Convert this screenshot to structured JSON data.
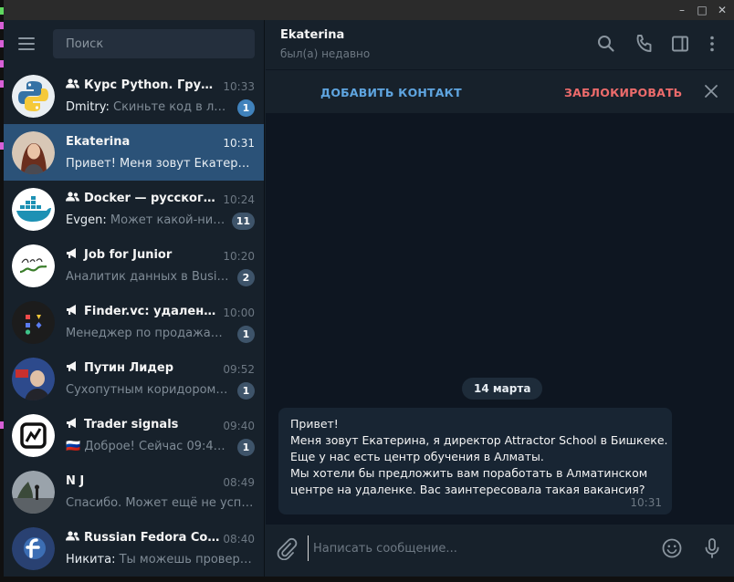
{
  "window": {
    "minimize_glyph": "–",
    "maximize_glyph": "□",
    "close_glyph": "✕"
  },
  "sidebar": {
    "search_placeholder": "Поиск",
    "chats": [
      {
        "title": "Курс Python. Группа ...",
        "type": "group",
        "time": "10:33",
        "sender": "Dmitry: ",
        "preview": "Скиньте код в личку",
        "unread": "1",
        "active": false
      },
      {
        "title": "Ekaterina",
        "type": "user",
        "time": "10:31",
        "sender": "",
        "preview": "Привет!  Меня зовут Екатерин...",
        "unread": "",
        "active": true
      },
      {
        "title": "Docker — русскогово...",
        "type": "group",
        "time": "10:24",
        "sender": "Evgen: ",
        "preview": "Может какой-нибуд...",
        "unread": "11",
        "active": false
      },
      {
        "title": "Job for Junior",
        "type": "channel",
        "time": "10:20",
        "sender": "",
        "preview": "Аналитик данных в Busines...",
        "unread": "2",
        "active": false
      },
      {
        "title": "Finder.vc: удаленная ...",
        "type": "channel",
        "time": "10:00",
        "sender": "",
        "preview": "Менеджер по продажам в ...",
        "unread": "1",
        "active": false
      },
      {
        "title": "Путин Лидер",
        "type": "channel",
        "time": "09:52",
        "sender": "",
        "preview": "Сухопутным коридором св...",
        "unread": "1",
        "active": false
      },
      {
        "title": "Trader signals",
        "type": "channel",
        "time": "09:40",
        "sender": "",
        "preview": "🇷🇺 Доброе! Сейчас 09:40 п...",
        "unread": "1",
        "active": false
      },
      {
        "title": "N J",
        "type": "user",
        "time": "08:49",
        "sender": "",
        "preview": "Спасибо. Может ещё не успели",
        "unread": "",
        "active": false
      },
      {
        "title": "Russian Fedora Com...",
        "type": "group",
        "time": "08:40",
        "sender": "Никита: ",
        "preview": "Ты можешь проверит...",
        "unread": "",
        "active": false
      }
    ]
  },
  "header": {
    "name": "Ekaterina",
    "status": "был(а) недавно"
  },
  "actions": {
    "add_contact": "ДОБАВИТЬ КОНТАКТ",
    "block": "ЗАБЛОКИРОВАТЬ"
  },
  "messages": {
    "date": "14 марта",
    "items": [
      {
        "lines": [
          "Привет!",
          "Меня зовут Екатерина, я директор Attractor School в Бишкеке.",
          "Еще у нас есть центр обучения в Алматы.",
          "Мы хотели бы предложить вам поработать в Алматинском",
          "центре на удаленке. Вас заинтересовала такая вакансия?"
        ],
        "time": "10:31"
      }
    ]
  },
  "composer": {
    "placeholder": "Написать сообщение..."
  },
  "colors": {
    "sidebar_bg": "#17212b",
    "chat_bg": "#0e1621",
    "active_row": "#2b5278",
    "accent": "#5fa5e0",
    "danger": "#ec6b6b"
  }
}
